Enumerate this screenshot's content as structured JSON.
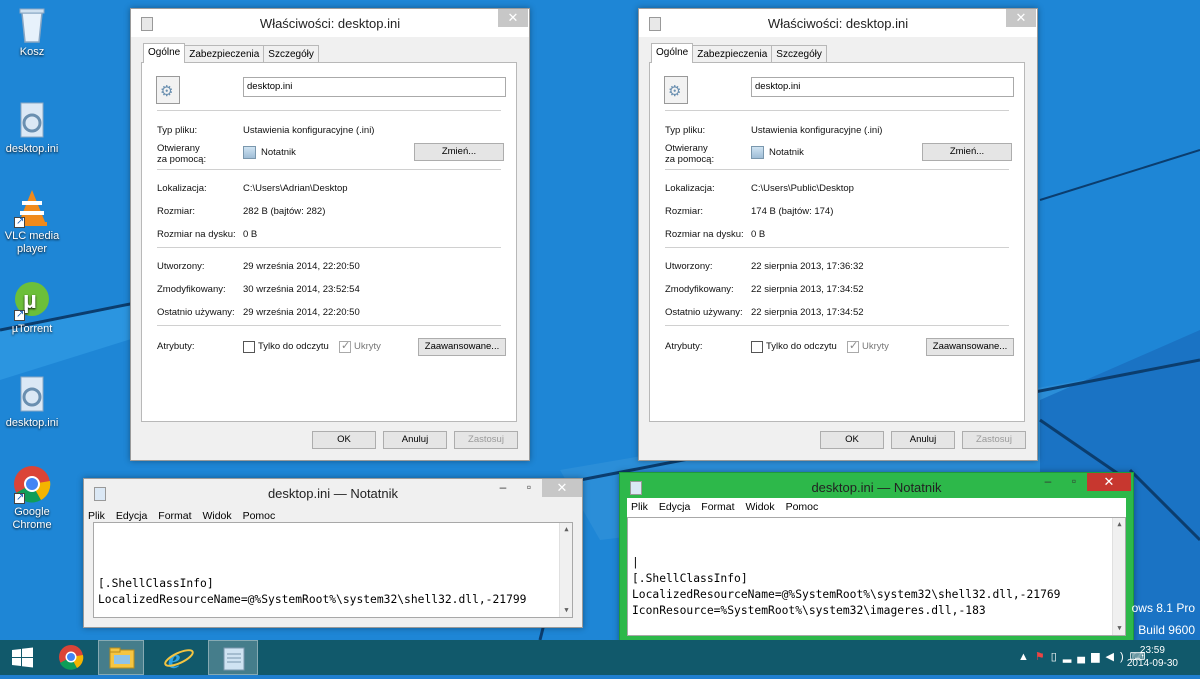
{
  "desktop": {
    "icons": [
      {
        "label": "Kosz",
        "icon": "recycle-bin-icon"
      },
      {
        "label": "desktop.ini",
        "icon": "settings-file-icon"
      },
      {
        "label": "VLC media player",
        "icon": "vlc-icon"
      },
      {
        "label": "µTorrent",
        "icon": "utorrent-icon"
      },
      {
        "label": "desktop.ini",
        "icon": "settings-file-icon"
      },
      {
        "label": "Google Chrome",
        "icon": "chrome-icon"
      }
    ],
    "watermark_line1": "ows 8.1 Pro",
    "watermark_line2": "Build 9600"
  },
  "props_common": {
    "tabs": [
      "Ogólne",
      "Zabezpieczenia",
      "Szczegóły"
    ],
    "type_label": "Typ pliku:",
    "openwith_label_1": "Otwierany",
    "openwith_label_2": "za pomocą:",
    "change_button": "Zmień...",
    "location_label": "Lokalizacja:",
    "size_label": "Rozmiar:",
    "size_on_disk_label": "Rozmiar na dysku:",
    "created_label": "Utworzony:",
    "modified_label": "Zmodyfikowany:",
    "accessed_label": "Ostatnio używany:",
    "attributes_label": "Atrybuty:",
    "readonly_label": "Tylko do odczytu",
    "hidden_label": "Ukryty",
    "advanced_button": "Zaawansowane...",
    "ok_button": "OK",
    "cancel_button": "Anuluj",
    "apply_button": "Zastosuj"
  },
  "props1": {
    "title": "Właściwości: desktop.ini",
    "filename": "desktop.ini",
    "type_value": "Ustawienia konfiguracyjne (.ini)",
    "openwith_value": "Notatnik",
    "location_value": "C:\\Users\\Adrian\\Desktop",
    "size_value": "282 B (bajtów: 282)",
    "size_on_disk_value": "0 B",
    "created_value": "29 września 2014, 22:20:50",
    "modified_value": "30 września 2014, 23:52:54",
    "accessed_value": "29 września 2014, 22:20:50",
    "readonly_checked": false,
    "hidden_checked": true
  },
  "props2": {
    "title": "Właściwości: desktop.ini",
    "filename": "desktop.ini",
    "type_value": "Ustawienia konfiguracyjne (.ini)",
    "openwith_value": "Notatnik",
    "location_value": "C:\\Users\\Public\\Desktop",
    "size_value": "174 B (bajtów: 174)",
    "size_on_disk_value": "0 B",
    "created_value": "22 sierpnia 2013, 17:36:32",
    "modified_value": "22 sierpnia 2013, 17:34:52",
    "accessed_value": "22 sierpnia 2013, 17:34:52",
    "readonly_checked": false,
    "hidden_checked": true
  },
  "notepad_common": {
    "menu": [
      "Plik",
      "Edycja",
      "Format",
      "Widok",
      "Pomoc"
    ]
  },
  "notepad1": {
    "title": "desktop.ini — Notatnik",
    "content": "\n[.ShellClassInfo]\nLocalizedResourceName=@%SystemRoot%\\system32\\shell32.dll,-21799"
  },
  "notepad2": {
    "title": "desktop.ini — Notatnik",
    "content": "|\n[.ShellClassInfo]\nLocalizedResourceName=@%SystemRoot%\\system32\\shell32.dll,-21769\nIconResource=%SystemRoot%\\system32\\imageres.dll,-183",
    "frame_color": "#2db84a"
  },
  "taskbar": {
    "time": "23:59",
    "date": "2014-09-30",
    "color": "#11596b"
  }
}
